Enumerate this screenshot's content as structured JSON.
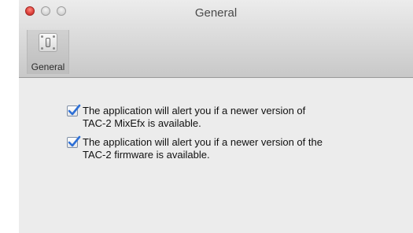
{
  "window": {
    "title": "General"
  },
  "toolbar": {
    "items": [
      {
        "label": "General",
        "icon": "switch-icon",
        "selected": true
      }
    ]
  },
  "options": [
    {
      "checked": true,
      "line1": "The application will alert you if a newer version of",
      "line2": "TAC-2 MixEfx is available."
    },
    {
      "checked": true,
      "line1": "The application will alert you if a newer version of the",
      "line2": "TAC-2 firmware is available."
    }
  ],
  "colors": {
    "checkmark": "#2d6fd6",
    "close_button": "#e0443e"
  }
}
